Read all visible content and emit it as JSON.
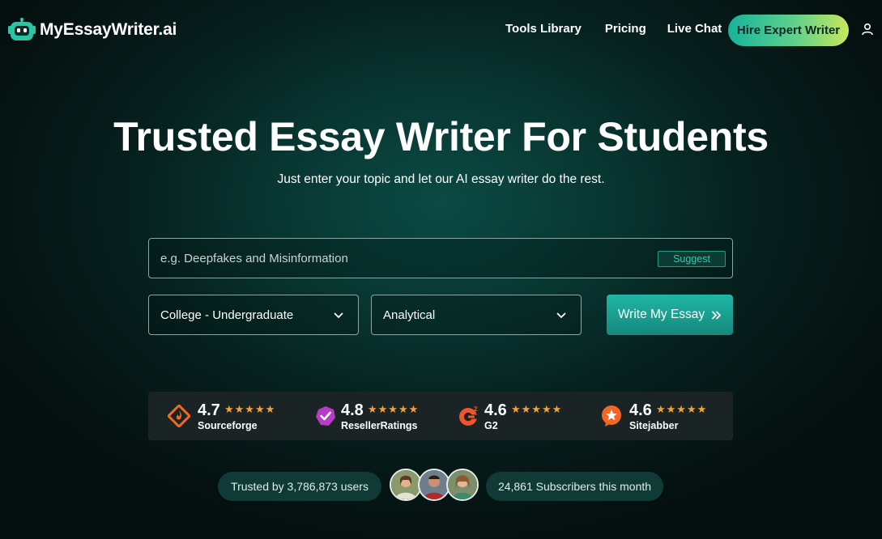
{
  "header": {
    "logo_text": "MyEssayWriter.ai",
    "nav": {
      "tools": "Tools Library",
      "pricing": "Pricing",
      "chat": "Live Chat"
    },
    "hire_button": "Hire Expert Writer",
    "user_icon": "user-icon"
  },
  "hero": {
    "title": "Trusted Essay Writer For Students",
    "subtitle": "Just enter your topic and let our AI essay writer do the rest."
  },
  "form": {
    "topic_placeholder": "e.g. Deepfakes and Misinformation",
    "topic_value": "",
    "suggest_label": "Suggest",
    "academic_level": "College - Undergraduate",
    "essay_type": "Analytical",
    "submit_label": "Write My Essay"
  },
  "ratings": [
    {
      "score": "4.7",
      "stars": "★★★★★",
      "name": "Sourceforge",
      "fill": 0.94,
      "color": "#f26a22"
    },
    {
      "score": "4.8",
      "stars": "★★★★★",
      "name": "ResellerRatings",
      "fill": 0.96,
      "color": "#b53cc4"
    },
    {
      "score": "4.6",
      "stars": "★★★★★",
      "name": "G2",
      "fill": 0.92,
      "color": "#f2542d"
    },
    {
      "score": "4.6",
      "stars": "★★★★★",
      "name": "Sitejabber",
      "fill": 0.92,
      "color": "#f26522"
    }
  ],
  "trust": {
    "users": "Trusted by 3,786,873 users",
    "subscribers": "24,861 Subscribers this month"
  },
  "colors": {
    "accent": "#16b39a",
    "star": "#f3a33a",
    "suggest": "#3dc7a7"
  }
}
